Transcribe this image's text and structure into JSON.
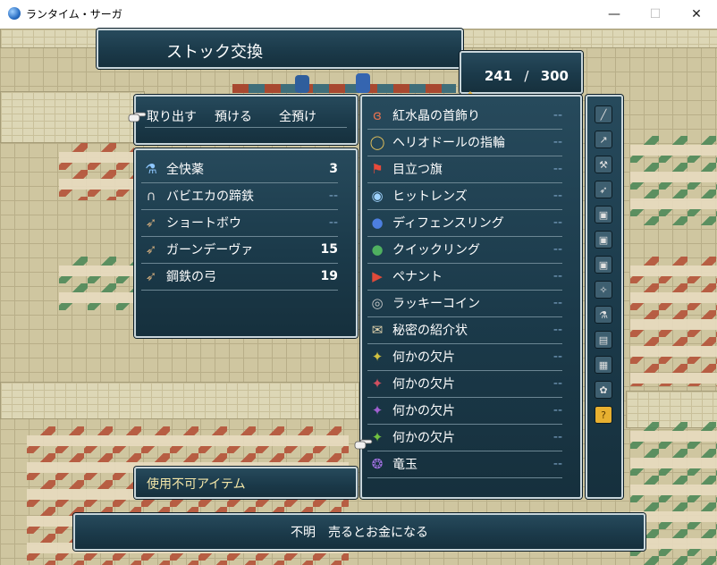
{
  "window": {
    "title": "ランタイム・サーガ",
    "minimize": "—",
    "maximize": "☐",
    "close": "✕"
  },
  "header": {
    "title": "ストック交換",
    "counter_current": "241",
    "counter_sep": "/",
    "counter_max": "300"
  },
  "commands": {
    "take": "取り出す",
    "deposit": "預ける",
    "deposit_all": "全預け"
  },
  "left_items": [
    {
      "name": "全快薬",
      "qty": "3",
      "icon": "potion-icon"
    },
    {
      "name": "バビエカの蹄鉄",
      "qty": "--",
      "icon": "horseshoe-icon"
    },
    {
      "name": "ショートボウ",
      "qty": "--",
      "icon": "bow-icon"
    },
    {
      "name": "ガーンデーヴァ",
      "qty": "15",
      "icon": "bow-icon"
    },
    {
      "name": "鋼鉄の弓",
      "qty": "19",
      "icon": "bow-icon"
    }
  ],
  "right_items": [
    {
      "name": "紅水晶の首飾り",
      "qty": "--",
      "icon": "necklace-icon"
    },
    {
      "name": "ヘリオドールの指輪",
      "qty": "--",
      "icon": "ring-icon"
    },
    {
      "name": "目立つ旗",
      "qty": "--",
      "icon": "flag-icon"
    },
    {
      "name": "ヒットレンズ",
      "qty": "--",
      "icon": "lens-icon"
    },
    {
      "name": "ディフェンスリング",
      "qty": "--",
      "icon": "blue-ring-icon"
    },
    {
      "name": "クイックリング",
      "qty": "--",
      "icon": "green-ring-icon"
    },
    {
      "name": "ペナント",
      "qty": "--",
      "icon": "pennant-icon"
    },
    {
      "name": "ラッキーコイン",
      "qty": "--",
      "icon": "coin-icon"
    },
    {
      "name": "秘密の紹介状",
      "qty": "--",
      "icon": "scroll-icon"
    },
    {
      "name": "何かの欠片",
      "qty": "--",
      "icon": "shard-yellow-icon"
    },
    {
      "name": "何かの欠片",
      "qty": "--",
      "icon": "shard-red-icon"
    },
    {
      "name": "何かの欠片",
      "qty": "--",
      "icon": "shard-purple-icon"
    },
    {
      "name": "何かの欠片",
      "qty": "--",
      "icon": "shard-green-icon"
    },
    {
      "name": "竜玉",
      "qty": "--",
      "icon": "dragon-orb-icon"
    }
  ],
  "category_tabs": [
    "sword-icon",
    "spear-icon",
    "axe-icon",
    "bow-icon",
    "tome-icon",
    "tome-icon",
    "tome-icon",
    "staff-icon",
    "potion-icon",
    "book-icon",
    "armor-icon",
    "accessory-icon",
    "unknown-icon"
  ],
  "status_label": "使用不可アイテム",
  "description": "不明　売るとお金になる",
  "colors": {
    "panel": "#1b3a4a",
    "border": "#c9d6db",
    "dash": "#7fa6c8",
    "cursor": "#e8b84a"
  }
}
